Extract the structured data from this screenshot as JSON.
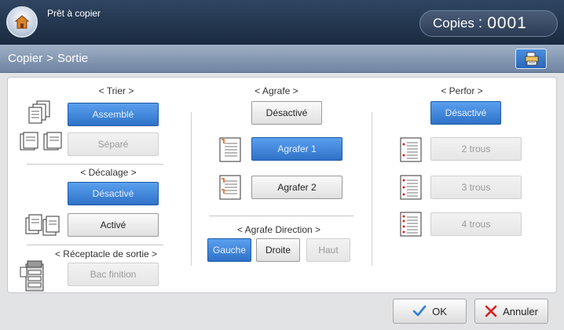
{
  "status": {
    "text": "Prêt à copier"
  },
  "copies": {
    "label": "Copies",
    "separator": ":",
    "value": "0001"
  },
  "breadcrumb": {
    "parent": "Copier",
    "separator": ">",
    "current": "Sortie"
  },
  "trier": {
    "label": "< Trier >",
    "options": [
      {
        "label": "Assemblé",
        "state": "selected"
      },
      {
        "label": "Séparé",
        "state": "disabled"
      }
    ]
  },
  "decalage": {
    "label": "< Décalage >",
    "options": [
      {
        "label": "Désactivé",
        "state": "selected"
      },
      {
        "label": "Activé",
        "state": "normal"
      }
    ]
  },
  "receptacle": {
    "label": "< Réceptacle de sortie >",
    "options": [
      {
        "label": "Bac finition",
        "state": "disabled"
      }
    ]
  },
  "agrafe": {
    "label": "< Agrafe >",
    "options": [
      {
        "label": "Désactivé",
        "state": "normal"
      },
      {
        "label": "Agrafer 1",
        "state": "selected"
      },
      {
        "label": "Agrafer 2",
        "state": "normal"
      }
    ]
  },
  "agrafe_direction": {
    "label": "< Agrafe Direction >",
    "options": [
      {
        "label": "Gauche",
        "state": "selected"
      },
      {
        "label": "Droite",
        "state": "normal"
      },
      {
        "label": "Haut",
        "state": "disabled"
      }
    ]
  },
  "perfor": {
    "label": "< Perfor >",
    "options": [
      {
        "label": "Désactivé",
        "state": "selected"
      },
      {
        "label": "2 trous",
        "state": "disabled"
      },
      {
        "label": "3 trous",
        "state": "disabled"
      },
      {
        "label": "4 trous",
        "state": "disabled"
      }
    ]
  },
  "actions": {
    "ok_label": "OK",
    "cancel_label": "Annuler"
  },
  "colors": {
    "accent": "#2f72c8",
    "topbar": "#1a2a40",
    "ok_check": "#2f7fd8",
    "cancel_x": "#d62020"
  },
  "icons": [
    "home-icon",
    "job-status-icon",
    "collate-icon",
    "separate-icon",
    "offset-icon",
    "finisher-icon",
    "staple-1-icon",
    "staple-2-icon",
    "punch-2-icon",
    "punch-3-icon",
    "punch-4-icon",
    "check-icon",
    "cross-icon"
  ]
}
